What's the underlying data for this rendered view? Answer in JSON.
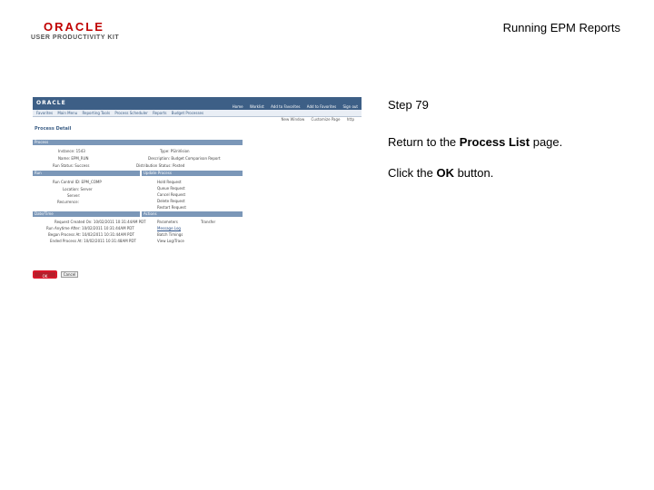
{
  "header": {
    "logo_oracle": "ORACLE",
    "logo_upk": "USER PRODUCTIVITY KIT",
    "doc_title": "Running EPM Reports"
  },
  "step": {
    "title": "Step 79",
    "instruction1_prefix": "Return to the ",
    "instruction1_bold": "Process List",
    "instruction1_suffix": " page.",
    "instruction2_prefix": "Click the ",
    "instruction2_bold": "OK",
    "instruction2_suffix": " button."
  },
  "screenshot": {
    "logo": "ORACLE",
    "top_links": [
      "Home",
      "Worklist",
      "Add to Favorites",
      "Add to Favorites",
      "Sign out"
    ],
    "menu": [
      "Favorites",
      "Main Menu",
      "Reporting Tools",
      "Process Scheduler",
      "Reports",
      "Budget Processes"
    ],
    "util_links": [
      "New Window",
      "Customize Page",
      "http"
    ],
    "page_title": "Process Detail",
    "process_section": "Process",
    "process_lines": [
      "Instance: 1543",
      "Type: PS/nVision",
      "Name: EPM_RUN",
      "Description: Budget Comparison Report",
      "Run Status: Success",
      "Distribution Status: Posted"
    ],
    "run_section": "Run",
    "run_lines": [
      "Run Control ID: EPM_COMP",
      "Location: Server",
      "Server:",
      "Recurrence:"
    ],
    "update_section": "Update Process",
    "update_lines": [
      "Hold Request",
      "Queue Request",
      "Cancel Request",
      "Delete Request",
      "Restart Request"
    ],
    "datetime_section": "Date/Time",
    "datetime_lines": [
      "Request Created On: 10/02/2011 10:31:44AM PDT",
      "Run Anytime After: 10/02/2011 10:31:44AM PDT",
      "Began Process At: 10/02/2011 10:31:44AM PDT",
      "Ended Process At: 10/02/2011 10:31:48AM PDT"
    ],
    "actions_section": "Actions",
    "actions_lines": [
      "Parameters",
      "Transfer",
      "Message Log",
      "Batch Timings",
      "View Log/Trace"
    ],
    "ok_label": "OK",
    "cancel_label": "Cancel"
  }
}
